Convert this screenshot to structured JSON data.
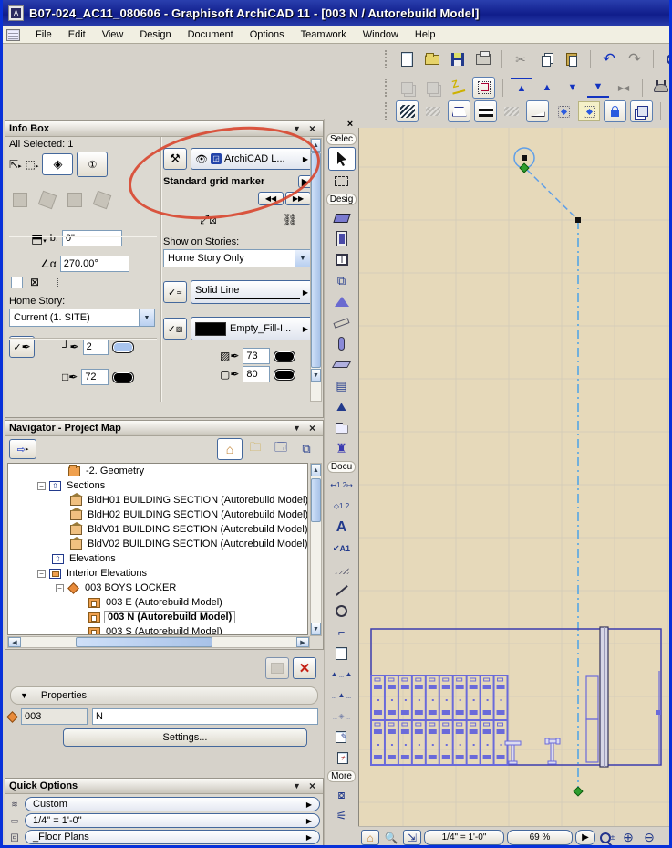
{
  "window": {
    "title": "B07-024_AC11_080606 - Graphisoft ArchiCAD 11 - [003 N / Autorebuild Model]"
  },
  "menubar": {
    "items": [
      "File",
      "Edit",
      "View",
      "Design",
      "Document",
      "Options",
      "Teamwork",
      "Window",
      "Help"
    ]
  },
  "glyphs": {
    "collapse": "▼",
    "close": "×",
    "right_small": "▶",
    "down_small": "▼",
    "up": "▲",
    "down": "▼",
    "left": "◀",
    "right": "▶",
    "dbl_left": "◀◀",
    "dbl_right": "▶▶",
    "cut": "✂",
    "undo": "↶",
    "redo": "↷",
    "tri_up": "▲",
    "tri_down": "▼",
    "pause": "▶◀",
    "zoom_in": "⊕",
    "zoom_out": "⊖",
    "plus_minus": "±",
    "check": "✓",
    "minus": "−",
    "one_circled": "①",
    "text_tool": "A",
    "label_tool": "A1",
    "dim": "1.2",
    "pen": "✒",
    "house": "⌂"
  },
  "infobox": {
    "title": "Info Box",
    "all_selected": "All Selected: 1",
    "layer_name": "ArchiCAD L...",
    "marker_name": "Standard grid marker",
    "b_label": "b:",
    "b_value": "0\"",
    "angle_value": "270.00°",
    "show_on_stories_label": "Show on Stories:",
    "show_on_stories_value": "Home Story Only",
    "home_story_label": "Home Story:",
    "home_story_value": "Current (1. SITE)",
    "line_type": "Solid Line",
    "pen_value": "2",
    "fill_name": "Empty_Fill-I...",
    "frame_pen": "72",
    "fill_pen": "73",
    "bg_pen": "80"
  },
  "navigator": {
    "title": "Navigator - Project Map",
    "tree": [
      {
        "label": "-2. Geometry"
      },
      {
        "label": "Sections"
      },
      {
        "label": "BldH01 BUILDING SECTION (Autorebuild Model)"
      },
      {
        "label": "BldH02 BUILDING SECTION (Autorebuild Model)"
      },
      {
        "label": "BldV01 BUILDING SECTION (Autorebuild Model)"
      },
      {
        "label": "BldV02 BUILDING SECTION (Autorebuild Model)"
      },
      {
        "label": "Elevations"
      },
      {
        "label": "Interior Elevations"
      },
      {
        "label": "003 BOYS LOCKER"
      },
      {
        "label": "003 E (Autorebuild Model)"
      },
      {
        "label": "003 N (Autorebuild Model)"
      },
      {
        "label": "003 S (Autorebuild Model)"
      }
    ]
  },
  "properties": {
    "header": "Properties",
    "id_value": "003",
    "name_value": "N",
    "settings_label": "Settings..."
  },
  "quick_options": {
    "title": "Quick Options",
    "layer_setting": "Custom",
    "scale_setting": "1/4\"  =   1'-0\"",
    "layer_combination": "_Floor Plans"
  },
  "toolbox": {
    "group_select": "Selec",
    "group_design": "Desig",
    "group_document": "Docu",
    "group_more": "More"
  },
  "statusbar": {
    "scale": "1/4\"  =  1'-0\"",
    "zoom_level": "69 %"
  },
  "colors": {
    "canvas_bg": "#e6d9ba",
    "locker_blue": "#6a6ada",
    "room_outline": "#3c3cae",
    "elevation_line": "#4aa3e8",
    "node_green": "#2f9e2f",
    "annotation_red": "#d8452e",
    "titlebar_blue": "#101d8b"
  }
}
